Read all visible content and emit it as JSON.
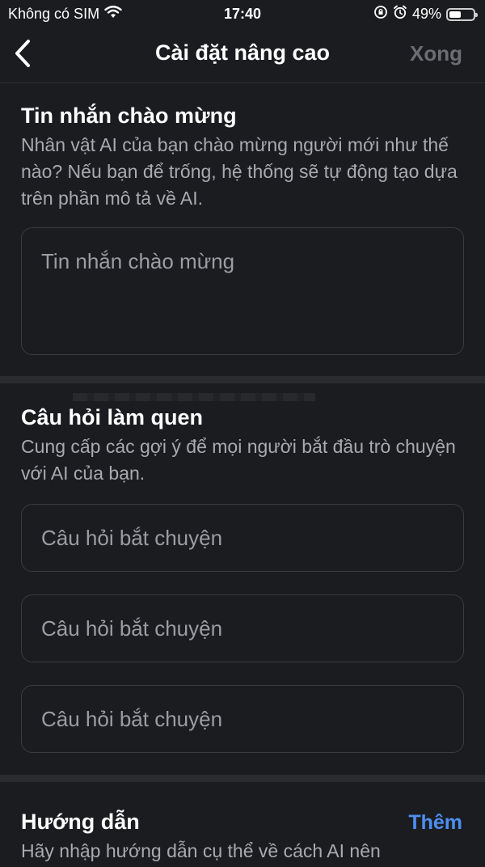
{
  "status_bar": {
    "carrier": "Không có SIM",
    "time": "17:40",
    "battery_percent": "49%",
    "battery_level": 0.49
  },
  "nav": {
    "title": "Cài đặt nâng cao",
    "done_label": "Xong"
  },
  "welcome": {
    "title": "Tin nhắn chào mừng",
    "description": "Nhân vật AI của bạn chào mừng người mới như thế nào? Nếu bạn để trống, hệ thống sẽ tự động tạo dựa trên phần mô tả về AI.",
    "placeholder": "Tin nhắn chào mừng"
  },
  "starters": {
    "title": "Câu hỏi làm quen",
    "description": "Cung cấp các gợi ý để mọi người bắt đầu trò chuyện với AI của bạn.",
    "inputs": [
      {
        "placeholder": "Câu hỏi bắt chuyện"
      },
      {
        "placeholder": "Câu hỏi bắt chuyện"
      },
      {
        "placeholder": "Câu hỏi bắt chuyện"
      }
    ]
  },
  "instructions": {
    "title": "Hướng dẫn",
    "add_label": "Thêm",
    "description": "Hãy nhập hướng dẫn cụ thể về cách AI nên"
  },
  "icons": {
    "back": "chevron-left-icon",
    "wifi": "wifi-icon",
    "rotation_lock": "rotation-lock-icon",
    "alarm": "alarm-icon",
    "battery": "battery-icon"
  },
  "colors": {
    "background": "#1b1c1f",
    "accent": "#4d8ff2",
    "muted_text": "#a8aab0",
    "disabled": "#6b6d72"
  }
}
